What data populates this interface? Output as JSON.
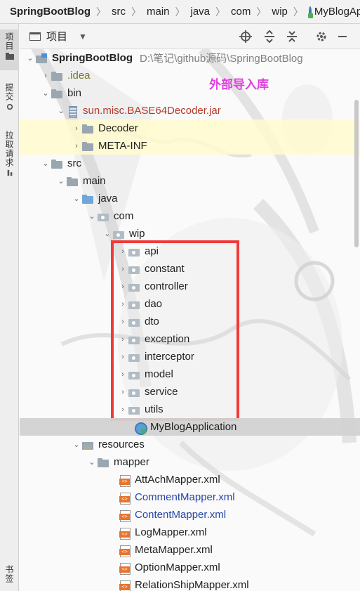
{
  "breadcrumb": {
    "items": [
      "SpringBootBlog",
      "src",
      "main",
      "java",
      "com",
      "wip"
    ],
    "last": "MyBlogAppli"
  },
  "left_strip": {
    "tabs": [
      "项目",
      "提交",
      "拉取请求",
      "书签"
    ]
  },
  "panel": {
    "title": "项目",
    "buttons": [
      "locate-icon",
      "expand-all-icon",
      "collapse-all-icon",
      "settings-icon",
      "hide-icon"
    ]
  },
  "annotation": "外部导入库",
  "tree": {
    "root": {
      "name": "SpringBootBlog",
      "path": "D:\\笔记\\github源码\\SpringBootBlog"
    },
    "idea": ".idea",
    "bin": "bin",
    "jar": "sun.misc.BASE64Decoder.jar",
    "decoder": "Decoder",
    "metainf": "META-INF",
    "src": "src",
    "main": "main",
    "java": "java",
    "com": "com",
    "wip": "wip",
    "packages": [
      "api",
      "constant",
      "controller",
      "dao",
      "dto",
      "exception",
      "interceptor",
      "model",
      "service",
      "utils"
    ],
    "app_class": "MyBlogApplication",
    "resources": "resources",
    "mapper": "mapper",
    "xml_files": [
      {
        "name": "AttAchMapper.xml",
        "color": "normal"
      },
      {
        "name": "CommentMapper.xml",
        "color": "blue"
      },
      {
        "name": "ContentMapper.xml",
        "color": "blue"
      },
      {
        "name": "LogMapper.xml",
        "color": "normal"
      },
      {
        "name": "MetaMapper.xml",
        "color": "normal"
      },
      {
        "name": "OptionMapper.xml",
        "color": "normal"
      },
      {
        "name": "RelationShipMapper.xml",
        "color": "normal"
      }
    ]
  },
  "colors": {
    "annotation": "#e040e0",
    "highlight_box": "#f03a3a",
    "library_text": "#b23a2a"
  }
}
